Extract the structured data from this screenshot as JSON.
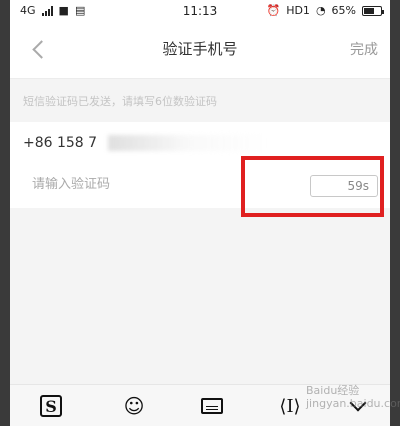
{
  "status_bar": {
    "network": "4G",
    "time": "11:13",
    "hd": "HD1",
    "battery": "65%",
    "battery_level": 0.65
  },
  "nav": {
    "title": "验证手机号",
    "done_label": "完成"
  },
  "hint": "短信验证码已发送，请填写6位数验证码",
  "phone": {
    "number": "+86 158 7"
  },
  "code": {
    "placeholder": "请输入验证码",
    "countdown": "59s"
  },
  "watermark": "Baidu经验\njingyan.baidu.com",
  "keyboard_toolbar": {
    "icons": [
      "sogou-icon",
      "emoji-icon",
      "keyboard-icon",
      "cursor-icon",
      "collapse-icon"
    ]
  },
  "colors": {
    "highlight": "#e02020",
    "background": "#f4f4f4"
  }
}
